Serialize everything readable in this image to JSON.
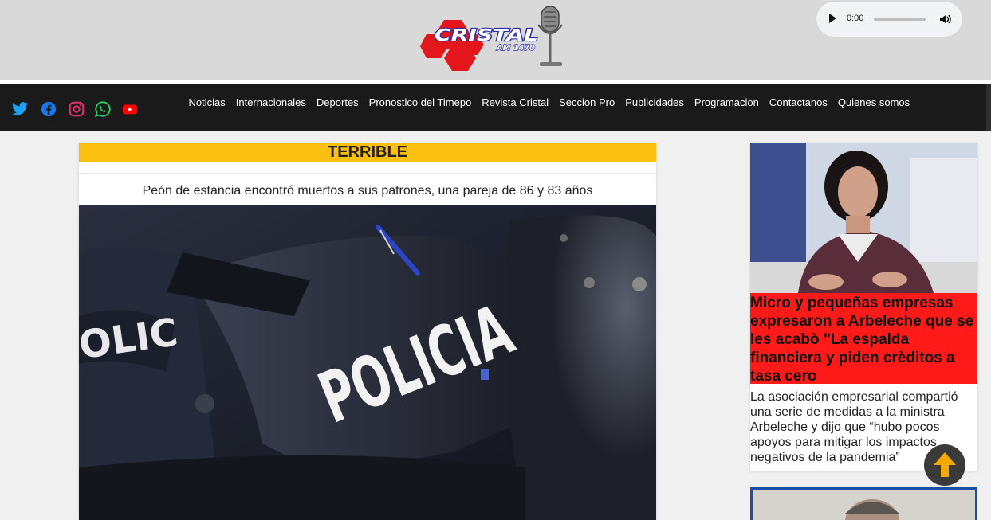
{
  "header": {
    "logo": {
      "brand": "CRISTAL",
      "sub": "AM 1470"
    },
    "audio": {
      "time": "0:00",
      "progress": 0
    }
  },
  "social": [
    {
      "name": "twitter-icon",
      "color": "#1da1f2"
    },
    {
      "name": "facebook-icon",
      "color": "#1877f2"
    },
    {
      "name": "instagram-icon",
      "color": "#e1306c"
    },
    {
      "name": "whatsapp-icon",
      "color": "#25d366"
    },
    {
      "name": "youtube-icon",
      "color": "#ff0000"
    }
  ],
  "nav": {
    "items": [
      "Noticias",
      "Internacionales",
      "Deportes",
      "Pronostico del Timepo",
      "Revista Cristal",
      "Seccion Pro",
      "Publicidades",
      "Programacion",
      "Contactanos",
      "Quienes somos"
    ]
  },
  "article": {
    "tag": "TERRIBLE",
    "subtitle": "Peón de estancia encontró muertos a sus patrones, una pareja de 86 y 83 años",
    "image_text": "POLICIA"
  },
  "side_card": {
    "headline": "Micro y pequeñas empresas expresaron a Arbeleche que se les acabò \"La espalda financiera y piden crèditos a tasa cero",
    "description": "La asociación empresarial compartió una serie de medidas a la ministra Arbeleche y dijo que “hubo pocos apoyos para mitigar los impactos negativos de la pandemia”"
  },
  "colors": {
    "tag_bg": "#f9c00f",
    "headline_bg": "#ff1a1a",
    "nav_bg": "#1a1a1a",
    "totop_arrow": "#f5a800"
  }
}
